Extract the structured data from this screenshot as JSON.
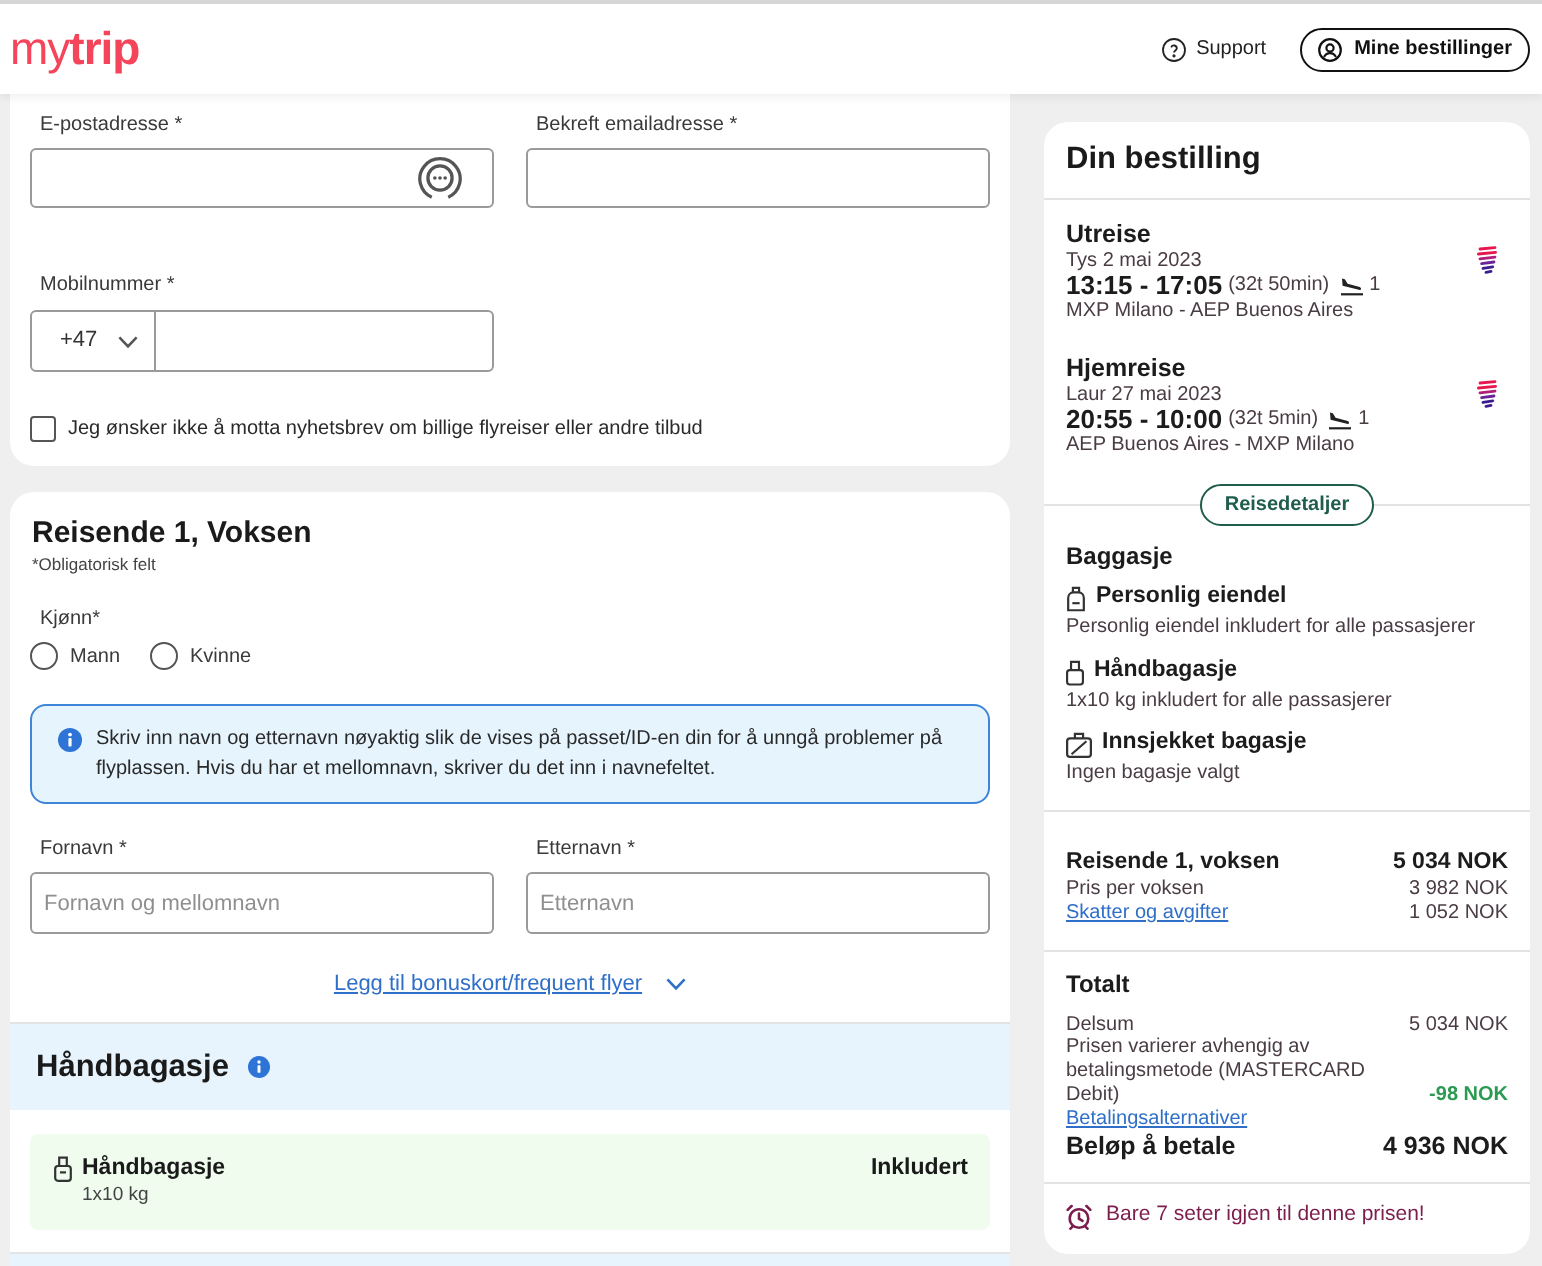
{
  "header": {
    "logo": "my**trip**",
    "support_link": "Support",
    "account_button": "Mine bestillinger"
  },
  "contact_form": {
    "email": {
      "label": "E-postadresse *"
    },
    "confirm_email": {
      "label": "Bekreft emailadresse *"
    },
    "mobile": {
      "label": "Mobilnummer *",
      "country_code": "+47"
    },
    "newsletter_opt_out": {
      "label": "Jeg ønsker ikke å motta nyhetsbrev om billige flyreiser eller andre tilbud",
      "checked": false
    }
  },
  "traveler_form": {
    "title": "Reisende 1, Voksen",
    "required_note": "*Obligatorisk felt",
    "gender": {
      "label": "Kjønn*",
      "options": [
        {
          "label": "Mann",
          "selected": false
        },
        {
          "label": "Kvinne",
          "selected": false
        }
      ]
    },
    "info": "Skriv inn navn og etternavn nøyaktig slik de vises på passet/ID-en din for å unngå problemer på flyplassen. Hvis du har et mellomnavn, skriver du det inn i navnefeltet.",
    "name_fields": [
      {
        "label": "Fornavn *",
        "placeholder": "Fornavn og mellomnavn"
      },
      {
        "label": "Etternavn *",
        "placeholder": "Etternavn"
      }
    ],
    "bonus_link": "Legg til bonuskort/frequent flyer"
  },
  "cabin_baggage": {
    "title": "Håndbagasje",
    "item": {
      "name": "Håndbagasje",
      "detail": "1x10 kg",
      "status": "Inkludert"
    }
  },
  "booking_summary": {
    "title": "Din bestilling",
    "legs": [
      {
        "title": "Utreise",
        "date": "Tys 2 mai 2023",
        "times": "13:15 - 17:05",
        "duration": "(32t 50min)",
        "stops": "1",
        "route": "MXP Milano - AEP Buenos Aires"
      },
      {
        "title": "Hjemreise",
        "date": "Laur 27 mai 2023",
        "times": "20:55 - 10:00",
        "duration": "(32t 5min)",
        "stops": "1",
        "route": "AEP Buenos Aires - MXP Milano"
      }
    ],
    "details_button": "Reisedetaljer",
    "baggage": {
      "title": "Baggasje",
      "items": [
        {
          "kind": "personal",
          "name": "Personlig eiendel",
          "detail": "Personlig eiendel inkludert for alle passasjerer"
        },
        {
          "kind": "cabin",
          "name": "Håndbagasje",
          "detail": "1x10 kg inkludert for alle passasjerer"
        },
        {
          "kind": "checked",
          "name": "Innsjekket bagasje",
          "detail": "Ingen bagasje valgt"
        }
      ]
    },
    "traveler_price": {
      "title": "Reisende 1, voksen",
      "amount": "5 034 NOK",
      "rows": [
        {
          "label": "Pris per voksen",
          "amount": "3 982 NOK",
          "link": false
        },
        {
          "label": "Skatter og avgifter",
          "amount": "1 052 NOK",
          "link": true
        }
      ]
    },
    "total": {
      "title": "Totalt",
      "subtotal": {
        "label": "Delsum",
        "amount": "5 034 NOK"
      },
      "payment_fee": {
        "label": "Prisen varierer avhengig av betalingsmetode (MASTERCARD Debit)",
        "amount": "-98 NOK"
      },
      "payment_link": "Betalingsalternativer",
      "due": {
        "label": "Beløp å betale",
        "amount": "4 936 NOK"
      }
    },
    "alert": "Bare 7 seter igjen til denne prisen!"
  }
}
